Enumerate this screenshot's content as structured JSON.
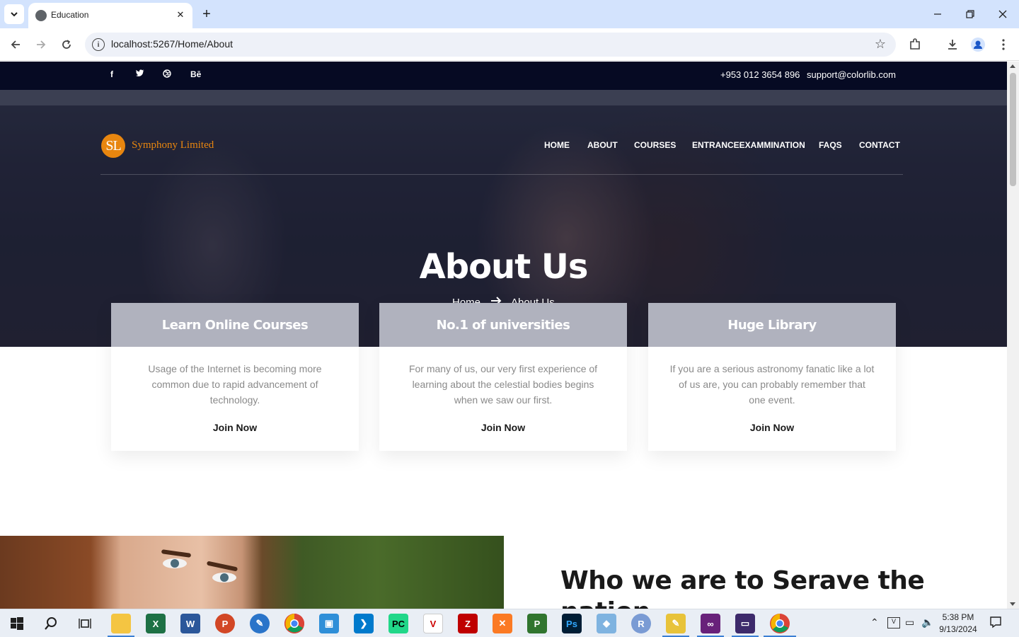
{
  "browser": {
    "tab_title": "Education",
    "url": "localhost:5267/Home/About"
  },
  "topbar": {
    "social": [
      "f",
      "t",
      "d",
      "Bē"
    ],
    "phone": "+953 012 3654 896",
    "email": "support@colorlib.com"
  },
  "brand": {
    "initials": "SL",
    "name": "Symphony Limited"
  },
  "nav": [
    {
      "label": "HOME"
    },
    {
      "label": "ABOUT"
    },
    {
      "label": "COURSES"
    },
    {
      "label": "ENTRANCEEXAMMINATION"
    },
    {
      "label": "FAQS"
    },
    {
      "label": "CONTACT"
    }
  ],
  "hero": {
    "title": "About Us",
    "breadcrumb_home": "Home",
    "breadcrumb_current": "About Us"
  },
  "cards": [
    {
      "title": "Learn Online Courses",
      "body": "Usage of the Internet is becoming more common due to rapid advancement of technology.",
      "cta": "Join Now"
    },
    {
      "title": "No.1 of universities",
      "body": "For many of us, our very first experience of learning about the celestial bodies begins when we saw our first.",
      "cta": "Join Now"
    },
    {
      "title": "Huge Library",
      "body": "If you are a serious astronomy fanatic like a lot of us are, you can probably remember that one event.",
      "cta": "Join Now"
    }
  ],
  "about_section": {
    "title": "Who we are to Serave the nation"
  },
  "taskbar": {
    "time": "5:38 PM",
    "date": "9/13/2024"
  },
  "colors": {
    "accent": "#e8860f",
    "topbar": "#060a23"
  }
}
